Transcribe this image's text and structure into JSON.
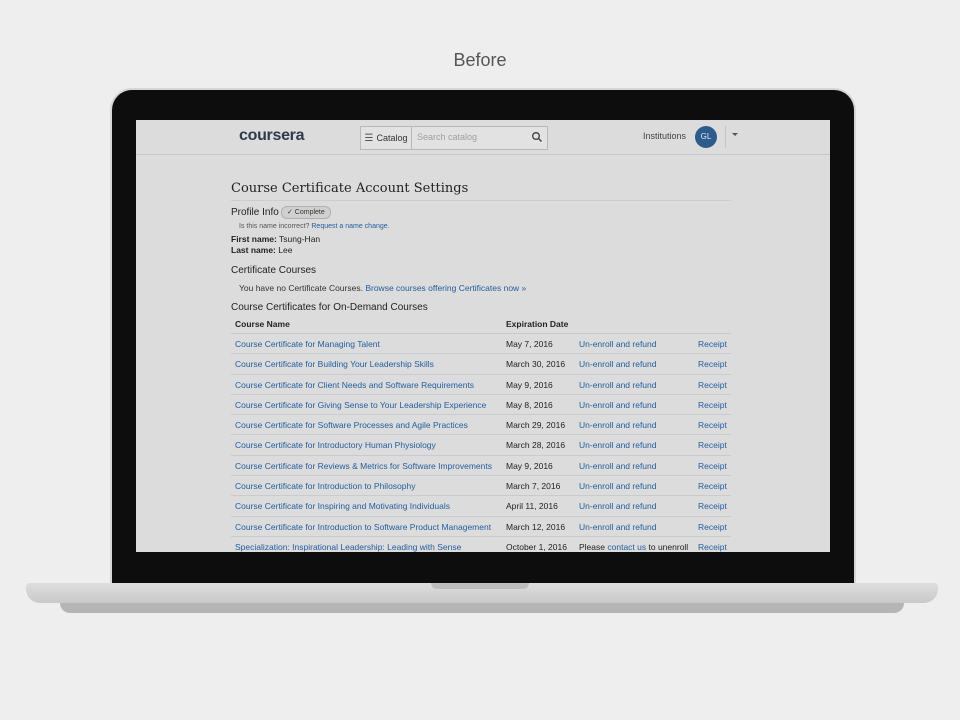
{
  "caption": "Before",
  "header": {
    "logo": "coursera",
    "catalog_label": "Catalog",
    "search_placeholder": "Search catalog",
    "institutions_label": "Institutions",
    "avatar_initials": "GL"
  },
  "page": {
    "title": "Course Certificate Account Settings",
    "profile_heading": "Profile Info",
    "profile_badge": "✓ Complete",
    "name_incorrect_prompt": "Is this name incorrect?",
    "name_change_link": "Request a name change.",
    "first_name_label": "First name:",
    "first_name_value": "Tsung-Han",
    "last_name_label": "Last name:",
    "last_name_value": "Lee",
    "cert_courses_heading": "Certificate Courses",
    "no_cert_text": "You have no Certificate Courses.",
    "browse_link": "Browse courses offering Certificates now »",
    "on_demand_heading": "Course Certificates for On-Demand Courses"
  },
  "table": {
    "col_course": "Course Name",
    "col_expiration": "Expiration Date",
    "rows": [
      {
        "course": "Course Certificate for Managing Talent",
        "date": "May 7, 2016",
        "action": "Un-enroll and refund",
        "receipt": "Receipt"
      },
      {
        "course": "Course Certificate for Building Your Leadership Skills",
        "date": "March 30, 2016",
        "action": "Un-enroll and refund",
        "receipt": "Receipt"
      },
      {
        "course": "Course Certificate for Client Needs and Software Requirements",
        "date": "May 9, 2016",
        "action": "Un-enroll and refund",
        "receipt": "Receipt"
      },
      {
        "course": "Course Certificate for Giving Sense to Your Leadership Experience",
        "date": "May 8, 2016",
        "action": "Un-enroll and refund",
        "receipt": "Receipt"
      },
      {
        "course": "Course Certificate for Software Processes and Agile Practices",
        "date": "March 29, 2016",
        "action": "Un-enroll and refund",
        "receipt": "Receipt"
      },
      {
        "course": "Course Certificate for Introductory Human Physiology",
        "date": "March 28, 2016",
        "action": "Un-enroll and refund",
        "receipt": "Receipt"
      },
      {
        "course": "Course Certificate for Reviews & Metrics for Software Improvements",
        "date": "May 9, 2016",
        "action": "Un-enroll and refund",
        "receipt": "Receipt"
      },
      {
        "course": "Course Certificate for Introduction to Philosophy",
        "date": "March 7, 2016",
        "action": "Un-enroll and refund",
        "receipt": "Receipt"
      },
      {
        "course": "Course Certificate for Inspiring and Motivating Individuals",
        "date": "April 11, 2016",
        "action": "Un-enroll and refund",
        "receipt": "Receipt"
      },
      {
        "course": "Course Certificate for Introduction to Software Product Management",
        "date": "March 12, 2016",
        "action": "Un-enroll and refund",
        "receipt": "Receipt"
      }
    ],
    "last_row": {
      "course": "Specialization: Inspirational Leadership: Leading with Sense",
      "date": "October 1, 2016",
      "action_prefix": "Please",
      "action_link": "contact us",
      "action_suffix": "to unenroll",
      "receipt": "Receipt"
    }
  }
}
